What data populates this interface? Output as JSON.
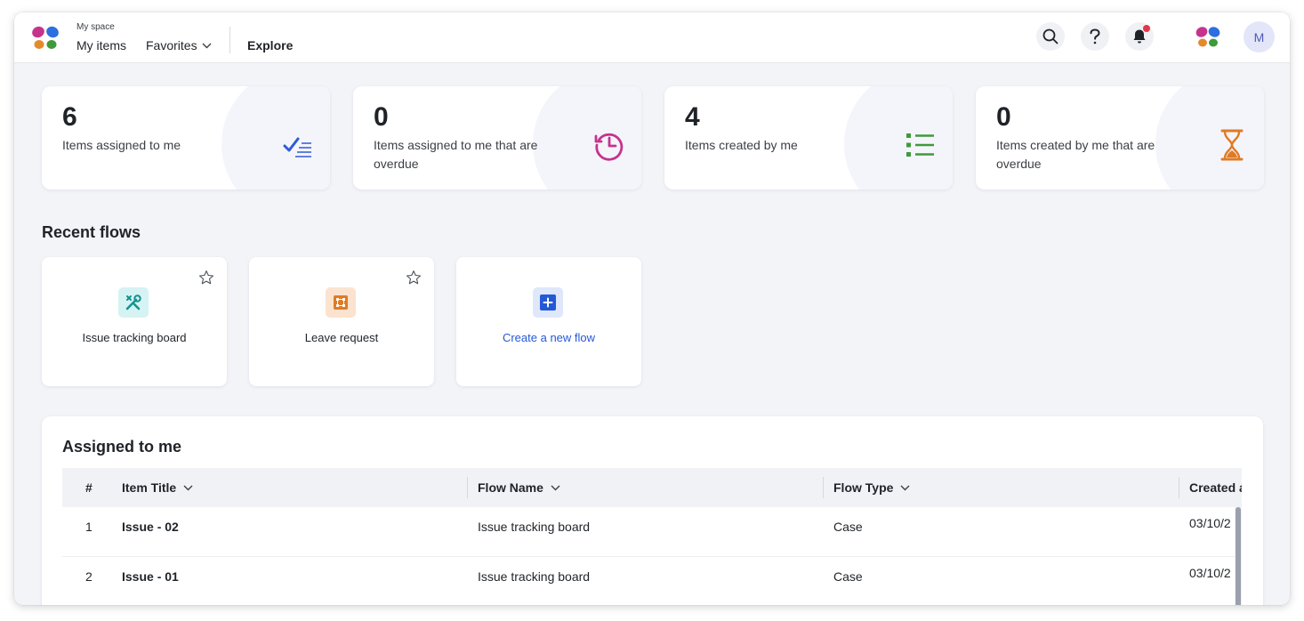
{
  "topbar": {
    "myspace_label": "My space",
    "nav_my_items": "My items",
    "nav_favorites": "Favorites",
    "nav_explore": "Explore",
    "avatar_initial": "M",
    "icons": [
      "search-icon",
      "help-icon",
      "bell-icon"
    ],
    "notification_dot_color": "#e2384a"
  },
  "stats": [
    {
      "value": "6",
      "label": "Items assigned to me",
      "icon": "checklist-icon",
      "icon_color": "#2e5bd8"
    },
    {
      "value": "0",
      "label": "Items assigned to me that are overdue",
      "icon": "history-clock-icon",
      "icon_color": "#c6338d"
    },
    {
      "value": "4",
      "label": "Items created by me",
      "icon": "list-icon",
      "icon_color": "#3f9a3a"
    },
    {
      "value": "0",
      "label": "Items created by me that are overdue",
      "icon": "hourglass-icon",
      "icon_color": "#e07b24"
    }
  ],
  "recent_flows": {
    "title": "Recent flows",
    "items": [
      {
        "label": "Issue tracking board",
        "icon": "tools-icon",
        "icon_bg": "#d6f3f4",
        "icon_color": "#13938f"
      },
      {
        "label": "Leave request",
        "icon": "grid-icon",
        "icon_bg": "#fbe3cf",
        "icon_color": "#e07b24"
      }
    ],
    "create_label": "Create a new flow"
  },
  "assigned": {
    "title": "Assigned to me",
    "columns": [
      "#",
      "Item Title",
      "Flow Name",
      "Flow Type",
      "Created a"
    ],
    "rows": [
      {
        "num": "1",
        "title": "Issue - 02",
        "flow": "Issue tracking board",
        "type": "Case",
        "created": "03/10/2"
      },
      {
        "num": "2",
        "title": "Issue - 01",
        "flow": "Issue tracking board",
        "type": "Case",
        "created": "03/10/2"
      }
    ]
  },
  "colors": {
    "accent_blue": "#2459d6",
    "page_bg": "#f3f4f8",
    "avatar_bg": "#e3e6f8"
  }
}
